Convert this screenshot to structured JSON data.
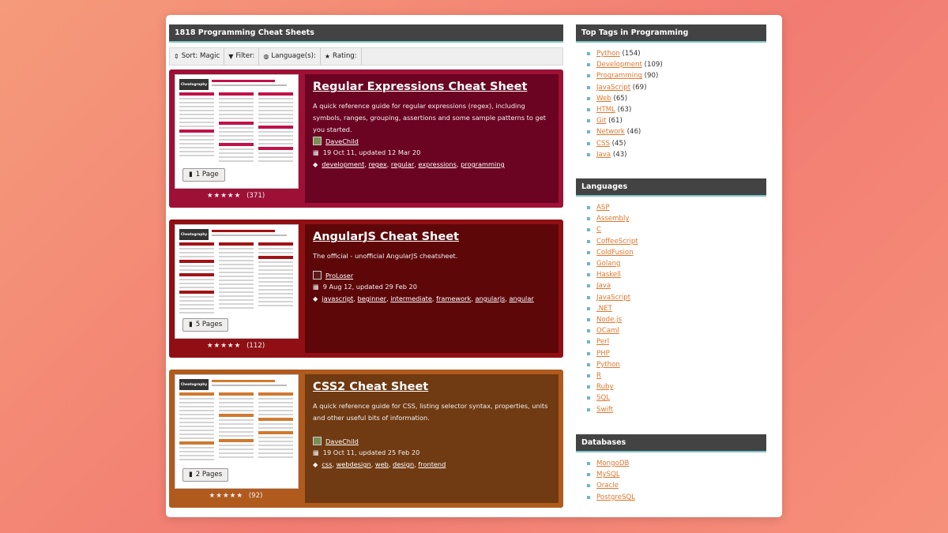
{
  "main": {
    "heading": "1818 Programming Cheat Sheets",
    "filters": [
      {
        "icon": "sort-icon",
        "glyph": "⇕",
        "label": "Sort: Magic"
      },
      {
        "icon": "filter-icon",
        "glyph": "▼",
        "label": "Filter:"
      },
      {
        "icon": "globe-icon",
        "glyph": "◍",
        "label": "Language(s):"
      },
      {
        "icon": "star-icon",
        "glyph": "★",
        "label": "Rating:"
      }
    ],
    "cards": [
      {
        "title": "Regular Expressions Cheat Sheet",
        "description": "A quick reference guide for regular expressions (regex), including symbols, ranges, grouping, assertions and some sample patterns to get you started.",
        "author": "DaveChild",
        "dates": "19 Oct 11, updated 12 Mar 20",
        "tags": [
          "development",
          "regex",
          "regular",
          "expressions",
          "programming"
        ],
        "pages": "1 Page",
        "stars": "★★★★★",
        "rating_count": "(371)",
        "thumb_brand": "Cheatography",
        "colors": {
          "outer": "#9e1035",
          "inner": "#6b0322",
          "accent": "#c0134a"
        }
      },
      {
        "title": "AngularJS Cheat Sheet",
        "description": "The official - unofficial AngularJS cheatsheet.",
        "author": "ProLoser",
        "dates": "9 Aug 12, updated 29 Feb 20",
        "tags": [
          "javascript",
          "beginner",
          "intermediate",
          "framework",
          "angularjs",
          "angular"
        ],
        "pages": "5 Pages",
        "stars": "★★★★★",
        "rating_count": "(112)",
        "thumb_brand": "Cheatography",
        "colors": {
          "outer": "#900f14",
          "inner": "#5e0709",
          "accent": "#a11317"
        }
      },
      {
        "title": "CSS2 Cheat Sheet",
        "description": "A quick reference guide for CSS, listing selector syntax, properties, units and other useful bits of information.",
        "author": "DaveChild",
        "dates": "19 Oct 11, updated 25 Feb 20",
        "tags": [
          "css",
          "webdesign",
          "web",
          "design",
          "frontend"
        ],
        "pages": "2 Pages",
        "stars": "★★★★★",
        "rating_count": "(92)",
        "thumb_brand": "Cheatography",
        "colors": {
          "outer": "#b05a1e",
          "inner": "#703a12",
          "accent": "#d07a30"
        }
      }
    ]
  },
  "sidebar": {
    "top_tags": {
      "title": "Top Tags in Programming",
      "items": [
        {
          "name": "Python",
          "count": "(154)"
        },
        {
          "name": "Development",
          "count": "(109)"
        },
        {
          "name": "Programming",
          "count": "(90)"
        },
        {
          "name": "JavaScript",
          "count": "(69)"
        },
        {
          "name": "Web",
          "count": "(65)"
        },
        {
          "name": "HTML",
          "count": "(63)"
        },
        {
          "name": "Git",
          "count": "(61)"
        },
        {
          "name": "Network",
          "count": "(46)"
        },
        {
          "name": "CSS",
          "count": "(45)"
        },
        {
          "name": "Java",
          "count": "(43)"
        }
      ]
    },
    "languages": {
      "title": "Languages",
      "items": [
        "ASP",
        "Assembly",
        "C",
        "CoffeeScript",
        "ColdFusion",
        "Golang",
        "Haskell",
        "Java",
        "JavaScript",
        ".NET",
        "Node.js",
        "OCaml",
        "Perl",
        "PHP",
        "Python",
        "R",
        "Ruby",
        "SQL",
        "Swift"
      ]
    },
    "databases": {
      "title": "Databases",
      "items": [
        "MongoDB",
        "MySQL",
        "Oracle",
        "PostgreSQL"
      ]
    }
  }
}
